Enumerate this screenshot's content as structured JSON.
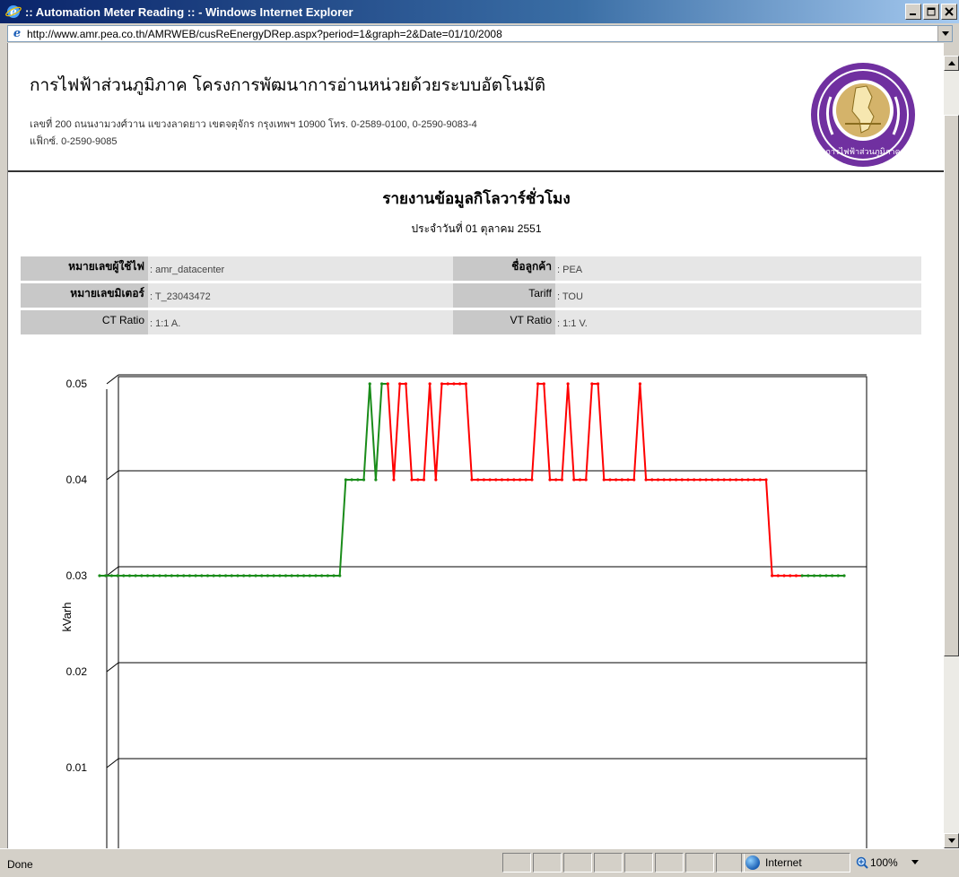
{
  "window": {
    "title": ":: Automation Meter Reading :: - Windows Internet Explorer",
    "buttons": {
      "minimize": "_",
      "maximize": "□",
      "close": "×"
    }
  },
  "address_bar": {
    "url": "http://www.amr.pea.co.th/AMRWEB/cusReEnergyDRep.aspx?period=1&graph=2&Date=01/10/2008"
  },
  "header": {
    "org_title": "การไฟฟ้าส่วนภูมิภาค โครงการพัฒนาการอ่านหน่วยด้วยระบบอัตโนมัติ",
    "address_line1": "เลขที่ 200 ถนนงามวงศ์วาน แขวงลาดยาว เขตจตุจักร กรุงเทพฯ 10900 โทร. 0-2589-0100, 0-2590-9083-4",
    "address_line2": "แฟ็กซ์. 0-2590-9085",
    "logo_text": "การไฟฟ้าส่วนภูมิภาค"
  },
  "report": {
    "title": "รายงานข้อมูลกิโลวาร์ชั่วโมง",
    "date": "ประจำวันที่ 01 ตุลาคม 2551"
  },
  "info": {
    "rows": [
      {
        "label": "หมายเลขผู้ใช้ไฟ",
        "value": ": amr_datacenter",
        "label2": "ชื่อลูกค้า",
        "value2": ": PEA"
      },
      {
        "label": "หมายเลขมิเตอร์",
        "value": ": T_23043472",
        "label2": "Tariff",
        "value2": ": TOU"
      },
      {
        "label": "CT Ratio",
        "value": ": 1:1 A.",
        "label2": "VT Ratio",
        "value2": ": 1:1 V."
      }
    ]
  },
  "chart_data": {
    "type": "line",
    "ylabel": "kVarh",
    "yticks": [
      "0.05",
      "0.04",
      "0.03",
      "0.02",
      "0.01"
    ],
    "ylim": [
      0,
      0.05
    ],
    "grid": true,
    "colors": {
      "on_peak": "#ff0000",
      "off_peak": "#1a8c1a"
    },
    "series": [
      {
        "values": [
          0.03,
          0.03,
          0.03,
          0.03,
          0.03,
          0.03,
          0.03,
          0.03,
          0.03,
          0.03,
          0.03,
          0.03,
          0.03,
          0.03,
          0.03,
          0.03,
          0.03,
          0.03,
          0.03,
          0.03,
          0.03,
          0.03,
          0.03,
          0.03,
          0.03,
          0.03,
          0.03,
          0.03,
          0.03,
          0.03,
          0.03,
          0.03,
          0.03,
          0.03,
          0.03,
          0.03,
          0.03,
          0.03,
          0.03,
          0.03,
          0.03,
          0.04,
          0.04,
          0.04,
          0.04,
          0.05,
          0.04,
          0.05,
          0.05,
          0.04,
          0.05,
          0.05,
          0.04,
          0.04,
          0.04,
          0.05,
          0.04,
          0.05,
          0.05,
          0.05,
          0.05,
          0.05,
          0.04,
          0.04,
          0.04,
          0.04,
          0.04,
          0.04,
          0.04,
          0.04,
          0.04,
          0.04,
          0.04,
          0.05,
          0.05,
          0.04,
          0.04,
          0.04,
          0.05,
          0.04,
          0.04,
          0.04,
          0.05,
          0.05,
          0.04,
          0.04,
          0.04,
          0.04,
          0.04,
          0.04,
          0.05,
          0.04,
          0.04,
          0.04,
          0.04,
          0.04,
          0.04,
          0.04,
          0.04,
          0.04,
          0.04,
          0.04,
          0.04,
          0.04,
          0.04,
          0.04,
          0.04,
          0.04,
          0.04,
          0.04,
          0.04,
          0.04,
          0.03,
          0.03,
          0.03,
          0.03,
          0.03,
          0.03,
          0.03,
          0.03,
          0.03,
          0.03,
          0.03,
          0.03,
          0.03
        ],
        "color_segments": [
          {
            "from": 0,
            "to": 48,
            "color": "off_peak"
          },
          {
            "from": 48,
            "to": 117,
            "color": "on_peak"
          },
          {
            "from": 117,
            "to": 126,
            "color": "off_peak"
          }
        ]
      }
    ]
  },
  "statusbar": {
    "left": "Done",
    "zone": "Internet",
    "zoom": "100%"
  }
}
